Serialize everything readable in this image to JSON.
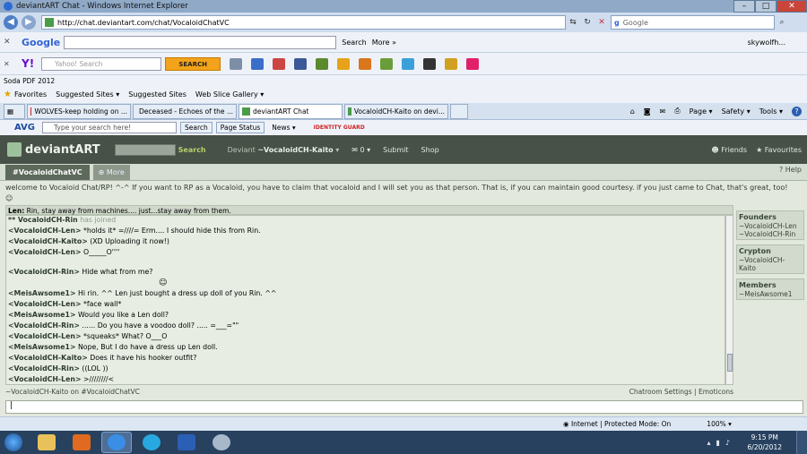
{
  "window": {
    "title": "deviantART Chat - Windows Internet Explorer",
    "min": "–",
    "max": "□",
    "close": "✕"
  },
  "address": {
    "url": "http://chat.deviantart.com/chat/VocaloidChatVC",
    "search_placeholder": "Google",
    "search_logo": "g"
  },
  "google_toolbar": {
    "logo": "Google",
    "search": "Search",
    "more": "More »",
    "user": "skywolfh..."
  },
  "yahoo_toolbar": {
    "logo": "Y!",
    "search_placeholder": "Yahoo! Search",
    "search_button": "SEARCH"
  },
  "soda": {
    "label": "Soda PDF 2012"
  },
  "favorites": {
    "label": "Favorites",
    "suggested1": "Suggested Sites ▾",
    "suggested2": "Suggested Sites",
    "webslice": "Web Slice Gallery ▾"
  },
  "tabs": [
    {
      "label": "WOLVES-keep holding on ...",
      "color": "#cc2222"
    },
    {
      "label": "Deceased - Echoes of the ...",
      "color": "#4a9b4a"
    },
    {
      "label": "deviantART Chat",
      "color": "#4a9b4a"
    },
    {
      "label": "VocaloidCH-Kaito on devi...",
      "color": "#4a9b4a"
    }
  ],
  "commandbar": {
    "page": "Page ▾",
    "safety": "Safety ▾",
    "tools": "Tools ▾",
    "help": "?"
  },
  "avg": {
    "logo": "AVG",
    "placeholder": "Type your search here!",
    "search": "Search",
    "page_status": "Page Status",
    "news": "News ▾",
    "guard": "IDENTITY GUARD"
  },
  "da": {
    "logo": "deviantART",
    "search": "Search",
    "deviant": "Deviant",
    "username": "~VocaloidCH-Kaito",
    "msgs": "0",
    "submit": "Submit",
    "shop": "Shop",
    "friends": "Friends",
    "favourites": "Favourites",
    "channel_tab": "#VocaloidChatVC",
    "more": "More",
    "help": "Help",
    "welcome": "welcome to Vocaloid Chat/RP! ^-^ If you want to RP as a Vocaloid, you have to claim that vocaloid and I will set you as that person. That is, if you can maintain good courtesy. if you just came to Chat, that's great, too! ☺",
    "topic_user": "Len:",
    "topic_text": " Rin, stay away from machines.... just...stay away from them.",
    "messages": [
      {
        "user": "** VocaloidCH-Rin",
        "text": " has joined",
        "join": true
      },
      {
        "user": "<VocaloidCH-Len>",
        "text": " *holds it* =////= Erm.... I should hide this from Rin."
      },
      {
        "user": "<VocaloidCH-Kaito>",
        "text": " (XD Uploading it now!)"
      },
      {
        "user": "<VocaloidCH-Len>",
        "text": " O_____O''''"
      },
      {
        "user": "<VocaloidCH-Rin>",
        "text": " Hide what from me?"
      },
      {
        "user": "<MeisAwsome1>",
        "text": " Hi rin. ^^ Len just bought a dress up doll of you Rin. ^^"
      },
      {
        "user": "<VocaloidCH-Len>",
        "text": " *face wall*"
      },
      {
        "user": "<MeisAwsome1>",
        "text": " Would you like a Len doll?"
      },
      {
        "user": "<VocaloidCH-Rin>",
        "text": " ...... Do you have a voodoo doll? ..... =___=\"\""
      },
      {
        "user": "<VocaloidCH-Len>",
        "text": " *squeaks* What? O___O"
      },
      {
        "user": "<MeisAwsome1>",
        "text": " Nope, But I do have a dress up Len doll."
      },
      {
        "user": "<VocaloidCH-Kaito>",
        "text": " Does it have his hooker outfit?"
      },
      {
        "user": "<VocaloidCH-Rin>",
        "text": " ((LOL ))"
      },
      {
        "user": "<VocaloidCH-Len>",
        "text": " >////////<"
      }
    ],
    "founders_label": "Founders",
    "founders": [
      "~VocaloidCH-Len",
      "~VocaloidCH-Rin"
    ],
    "crypton_label": "Crypton",
    "crypton": [
      "~VocaloidCH-Kaito"
    ],
    "members_label": "Members",
    "members": [
      "~MeisAwsome1"
    ],
    "status_left": "~VocaloidCH-Kaito on #VocaloidChatVC",
    "status_right": "Chatroom Settings | Emoticons",
    "input_value": "|"
  },
  "iestatus": {
    "zone": "Internet | Protected Mode: On",
    "zoom": "100% ▾"
  },
  "taskbar": {
    "time": "9:15 PM",
    "date": "6/20/2012"
  }
}
